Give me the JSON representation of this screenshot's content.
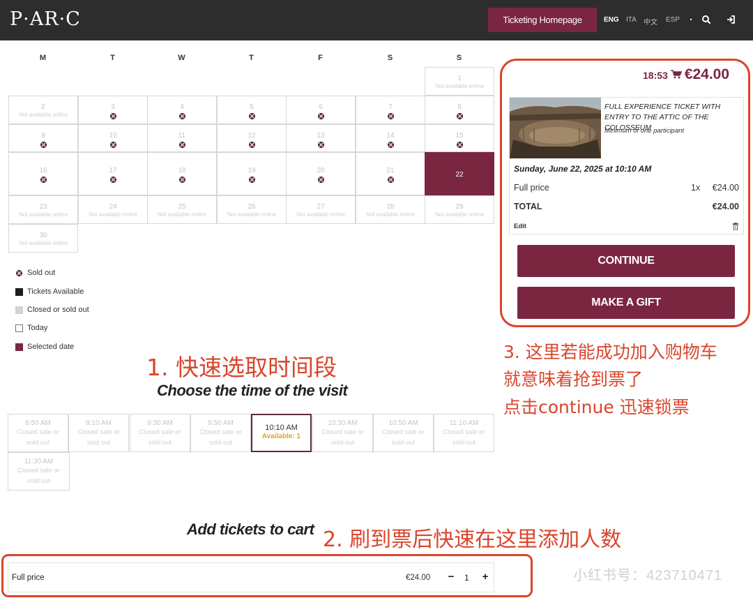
{
  "header": {
    "logo": "P·AR·C",
    "homepage_button": "Ticketing Homepage",
    "languages": [
      {
        "label": "ENG",
        "active": true
      },
      {
        "label": "ITA",
        "active": false
      },
      {
        "label": "中文",
        "active": false
      },
      {
        "label": "ESP",
        "active": false
      }
    ],
    "icons": [
      "dot-icon",
      "search-icon",
      "login-icon"
    ]
  },
  "calendar": {
    "weekdays": [
      "M",
      "T",
      "W",
      "T",
      "F",
      "S",
      "S"
    ],
    "not_available_label": "Not available online",
    "weeks": [
      [
        null,
        null,
        null,
        null,
        null,
        null,
        {
          "day": "1",
          "status": "na"
        }
      ],
      [
        {
          "day": "2",
          "status": "na"
        },
        {
          "day": "3",
          "status": "sold"
        },
        {
          "day": "4",
          "status": "sold"
        },
        {
          "day": "5",
          "status": "sold"
        },
        {
          "day": "6",
          "status": "sold"
        },
        {
          "day": "7",
          "status": "sold"
        },
        {
          "day": "8",
          "status": "sold"
        }
      ],
      [
        {
          "day": "9",
          "status": "sold"
        },
        {
          "day": "10",
          "status": "sold"
        },
        {
          "day": "11",
          "status": "sold"
        },
        {
          "day": "12",
          "status": "sold"
        },
        {
          "day": "13",
          "status": "sold"
        },
        {
          "day": "14",
          "status": "sold"
        },
        {
          "day": "15",
          "status": "sold"
        }
      ],
      [
        {
          "day": "16",
          "status": "sold"
        },
        {
          "day": "17",
          "status": "sold"
        },
        {
          "day": "18",
          "status": "sold"
        },
        {
          "day": "19",
          "status": "sold"
        },
        {
          "day": "20",
          "status": "sold"
        },
        {
          "day": "21",
          "status": "sold"
        },
        {
          "day": "22",
          "status": "selected"
        }
      ],
      [
        {
          "day": "23",
          "status": "na"
        },
        {
          "day": "24",
          "status": "na"
        },
        {
          "day": "25",
          "status": "na"
        },
        {
          "day": "26",
          "status": "na"
        },
        {
          "day": "27",
          "status": "na"
        },
        {
          "day": "28",
          "status": "na"
        },
        {
          "day": "29",
          "status": "na"
        }
      ],
      [
        {
          "day": "30",
          "status": "na"
        },
        null,
        null,
        null,
        null,
        null,
        null
      ]
    ]
  },
  "legend": [
    {
      "label": "Sold out",
      "type": "sold"
    },
    {
      "label": "Tickets Available",
      "type": "available"
    },
    {
      "label": "Closed or sold out",
      "type": "closed"
    },
    {
      "label": "Today",
      "type": "today"
    },
    {
      "label": "Selected date",
      "type": "selected"
    }
  ],
  "annotations": {
    "step1": "1. 快速选取时间段",
    "step2": "2. 刷到票后快速在这里添加人数",
    "step3_line1": "3. 这里若能成功加入购物车",
    "step3_line2": "就意味着抢到票了",
    "step3_line3": "点击continue 迅速锁票",
    "watermark": "小红书号：423710471"
  },
  "time_section": {
    "title": "Choose the time of the visit",
    "slots": [
      {
        "time": "8:50 AM",
        "status": "Closed sale or sold out",
        "available": false
      },
      {
        "time": "9:10 AM",
        "status": "Closed sale or sold out",
        "available": false
      },
      {
        "time": "9:30 AM",
        "status": "Closed sale or sold out",
        "available": false
      },
      {
        "time": "9:50 AM",
        "status": "Closed sale or sold out",
        "available": false
      },
      {
        "time": "10:10 AM",
        "status": "Available: 1",
        "available": true
      },
      {
        "time": "10:30 AM",
        "status": "Closed sale or sold out",
        "available": false
      },
      {
        "time": "10:50 AM",
        "status": "Closed sale or sold out",
        "available": false
      },
      {
        "time": "11:10 AM",
        "status": "Closed sale or sold out",
        "available": false
      },
      {
        "time": "11:30 AM",
        "status": "Closed sale or sold out",
        "available": false
      }
    ]
  },
  "cart": {
    "timer": "18:53",
    "total_price": "€24.00",
    "ticket_title": "FULL EXPERIENCE TICKET WITH ENTRY TO THE ATTIC OF THE COLOSSEUM",
    "ticket_min": "Minimum of one participant",
    "visit_date": "Sunday, June 22, 2025 at 10:10 AM",
    "full_price_label": "Full price",
    "full_price_qty": "1x",
    "full_price_amount": "€24.00",
    "total_label": "TOTAL",
    "total_amount": "€24.00",
    "edit_label": "Edit",
    "continue_label": "CONTINUE",
    "gift_label": "MAKE A GIFT"
  },
  "add_tickets": {
    "title": "Add tickets to cart",
    "row_label": "Full price",
    "row_price": "€24.00",
    "minus": "−",
    "quantity": "1",
    "plus": "+"
  },
  "colors": {
    "brand": "#7b2641",
    "header_bg": "#2e2d2d",
    "annotation": "#d9452c",
    "available_text": "#e2a11b"
  }
}
